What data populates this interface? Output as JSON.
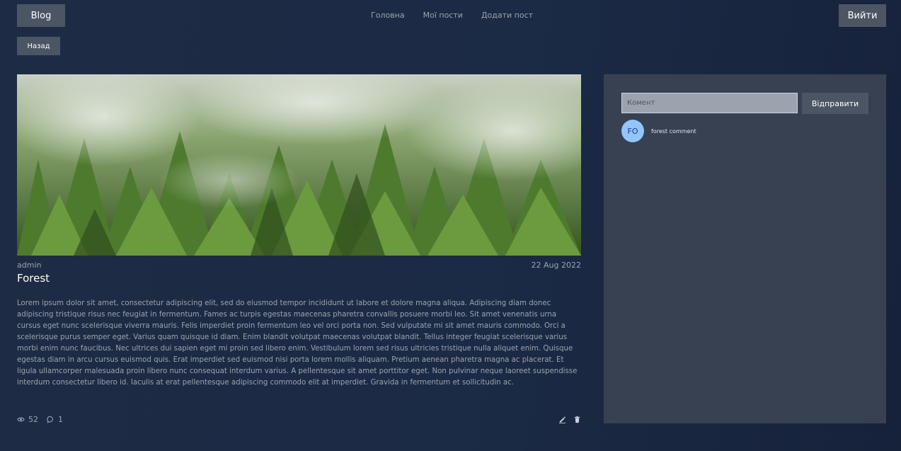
{
  "header": {
    "logo_label": "Blog",
    "nav": [
      {
        "label": "Головна"
      },
      {
        "label": "Мої пости"
      },
      {
        "label": "Додати пост"
      }
    ],
    "login_label": "Вийти"
  },
  "back_label": "Назад",
  "post": {
    "author": "admin",
    "date": "22 Aug 2022",
    "title": "Forest",
    "body": "Lorem ipsum dolor sit amet, consectetur adipiscing elit, sed do eiusmod tempor incididunt ut labore et dolore magna aliqua. Adipiscing diam donec adipiscing tristique risus nec feugiat in fermentum. Fames ac turpis egestas maecenas pharetra convallis posuere morbi leo. Sit amet venenatis urna cursus eget nunc scelerisque viverra mauris. Felis imperdiet proin fermentum leo vel orci porta non. Sed vulputate mi sit amet mauris commodo. Orci a scelerisque purus semper eget. Varius quam quisque id diam. Enim blandit volutpat maecenas volutpat blandit. Tellus integer feugiat scelerisque varius morbi enim nunc faucibus. Nec ultrices dui sapien eget mi proin sed libero enim. Vestibulum lorem sed risus ultricies tristique nulla aliquet enim. Quisque egestas diam in arcu cursus euismod quis. Erat imperdiet sed euismod nisi porta lorem mollis aliquam. Pretium aenean pharetra magna ac placerat. Et ligula ullamcorper malesuada proin libero nunc consequat interdum varius. A pellentesque sit amet porttitor eget. Non pulvinar neque laoreet suspendisse interdum consectetur libero id. Iaculis at erat pellentesque adipiscing commodo elit at imperdiet. Gravida in fermentum et sollicitudin ac.",
    "views": "52",
    "comments_count": "1",
    "icons": {
      "views": "eye-icon",
      "comments": "comment-icon",
      "edit": "pencil-icon",
      "delete": "trash-icon"
    }
  },
  "comments": {
    "input_placeholder": "Комент",
    "input_value": "",
    "send_label": "Відправити",
    "items": [
      {
        "avatar_initials": "FO",
        "text": "forest comment"
      }
    ]
  },
  "colors": {
    "background": "#1e2b44",
    "button": "#4b5563",
    "panel": "#374151",
    "avatar": "#93c5fd"
  }
}
